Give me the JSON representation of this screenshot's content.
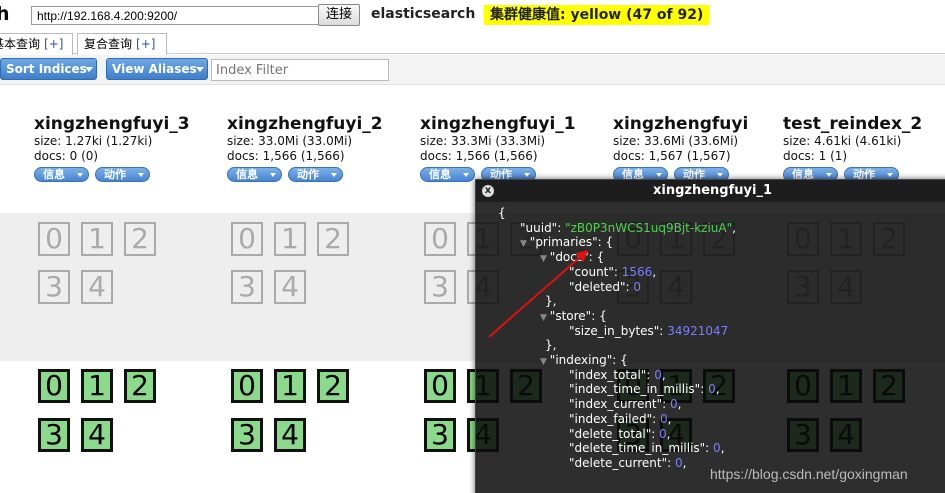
{
  "header": {
    "logo_letter": "h",
    "url_value": "http://192.168.4.200:9200/",
    "connect_label": "连接",
    "cluster_name": "elasticsearch",
    "health_label": "集群健康值: yellow (47 of 92)",
    "health_color": "#ffff00"
  },
  "tabs": [
    {
      "label": "基本查询",
      "plus": "[+]"
    },
    {
      "label": "复合查询",
      "plus": "[+]"
    }
  ],
  "toolbar": {
    "sort_label": "Sort Indices",
    "alias_label": "View Aliases",
    "filter_placeholder": "Index Filter"
  },
  "indices": [
    {
      "name": "xingzhengfuyi_3",
      "size": "size: 1.27ki (1.27ki)",
      "docs": "docs: 0 (0)",
      "info": "信息",
      "action": "动作"
    },
    {
      "name": "xingzhengfuyi_2",
      "size": "size: 33.0Mi (33.0Mi)",
      "docs": "docs: 1,566 (1,566)",
      "info": "信息",
      "action": "动作"
    },
    {
      "name": "xingzhengfuyi_1",
      "size": "size: 33.3Mi (33.3Mi)",
      "docs": "docs: 1,566 (1,566)",
      "info": "信息",
      "action": "动作"
    },
    {
      "name": "xingzhengfuyi",
      "size": "size: 33.6Mi (33.6Mi)",
      "docs": "docs: 1,567 (1,567)",
      "info": "信息",
      "action": "动作"
    },
    {
      "name": "test_reindex_2",
      "size": "size: 4.61ki (4.61ki)",
      "docs": "docs: 1 (1)",
      "info": "信息",
      "action": "动作"
    }
  ],
  "shards": {
    "unassigned": [
      "0",
      "1",
      "2",
      "3",
      "4"
    ],
    "assigned": [
      "0",
      "1",
      "2",
      "3",
      "4"
    ],
    "unassigned_color": "#aaaaaa",
    "assigned_color": "#8bd98b"
  },
  "popup": {
    "title": "xingzhengfuyi_1",
    "close_glyph": "x",
    "lines": [
      {
        "t": "{"
      },
      {
        "k": "\"uuid\":",
        "s": "\"zB0P3nWCS1uq9Bjt-kziuA\"",
        "tail": ","
      },
      {
        "k": "\"primaries\":",
        "tail": " {",
        "tog": true
      },
      {
        "k": "\"docs\":",
        "tail": " {",
        "tog": true
      },
      {
        "k": "\"count\":",
        "n": "1566",
        "tail": ","
      },
      {
        "k": "\"deleted\":",
        "n": "0"
      },
      {
        "t": "},"
      },
      {
        "k": "\"store\":",
        "tail": " {",
        "tog": true
      },
      {
        "k": "\"size_in_bytes\":",
        "n": "34921047"
      },
      {
        "t": "},"
      },
      {
        "k": "\"indexing\":",
        "tail": " {",
        "tog": true
      },
      {
        "k": "\"index_total\":",
        "n": "0",
        "tail": ","
      },
      {
        "k": "\"index_time_in_millis\":",
        "n": "0",
        "tail": ","
      },
      {
        "k": "\"index_current\":",
        "n": "0",
        "tail": ","
      },
      {
        "k": "\"index_failed\":",
        "n": "0",
        "tail": ","
      },
      {
        "k": "\"delete_total\":",
        "n": "0",
        "tail": ","
      },
      {
        "k": "\"delete_time_in_millis\":",
        "n": "0",
        "tail": ","
      },
      {
        "k": "\"delete_current\":",
        "n": "0",
        "tail": ","
      }
    ]
  },
  "watermark": "https://blog.csdn.net/goxingman"
}
